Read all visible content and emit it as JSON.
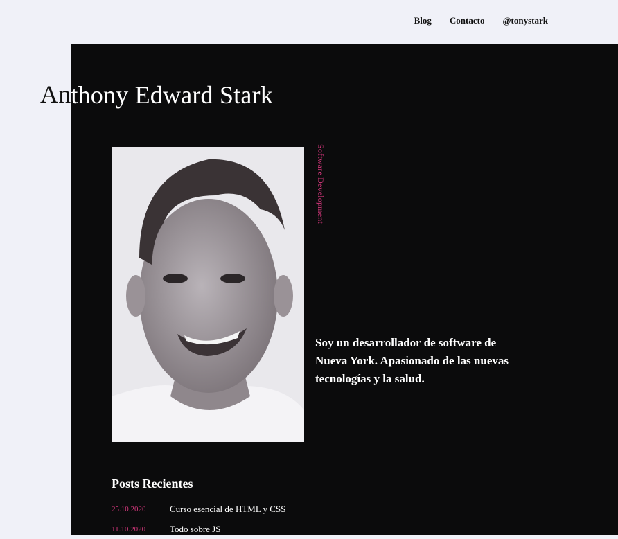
{
  "nav": {
    "blog": "Blog",
    "contact": "Contacto",
    "handle": "@tonystark"
  },
  "hero": {
    "name": "Anthony Edward Stark",
    "tagline": "Software Development",
    "bio": "Soy un desarrollador de software de Nueva York. Apasionado de las nuevas tecnologías y la salud."
  },
  "posts": {
    "title": "Posts Recientes",
    "items": [
      {
        "date": "25.10.2020",
        "title": "Curso esencial de HTML y CSS"
      },
      {
        "date": "11.10.2020",
        "title": "Todo sobre JS"
      }
    ]
  },
  "colors": {
    "background": "#f0f1f8",
    "panel": "#0b0b0c",
    "accent": "#d1367a"
  }
}
